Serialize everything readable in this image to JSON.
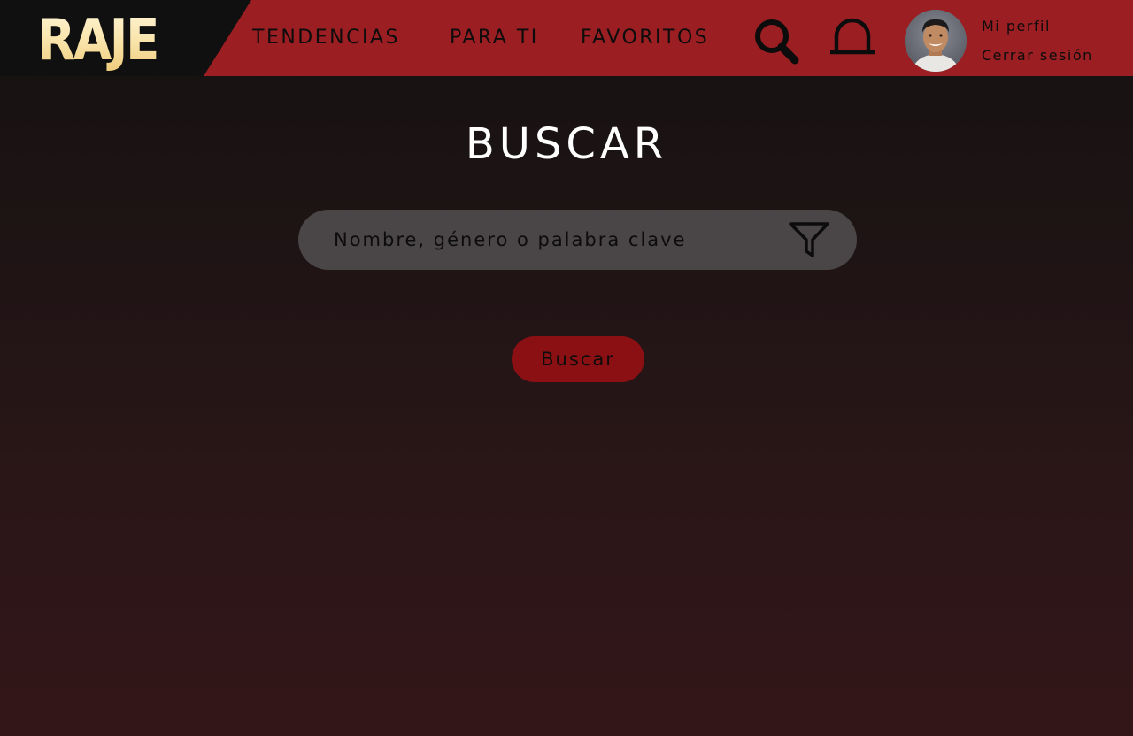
{
  "brand": {
    "logo_text": "RAJE"
  },
  "nav": {
    "items": [
      {
        "label": "TENDENCIAS"
      },
      {
        "label": "PARA TI"
      },
      {
        "label": "FAVORITOS"
      }
    ]
  },
  "header": {
    "search_icon": "search-icon",
    "notifications_icon": "bell-icon",
    "profile_label": "Mi perfil",
    "logout_label": "Cerrar sesión"
  },
  "main": {
    "title": "BUSCAR",
    "search": {
      "value": "",
      "placeholder": "Nombre, género o palabra clave",
      "filter_icon": "filter-icon"
    },
    "submit_label": "Buscar"
  },
  "colors": {
    "header_red": "#9a1e22",
    "logo_bg": "#101010",
    "button_red": "#8a1013",
    "input_bg": "#4a4546"
  }
}
